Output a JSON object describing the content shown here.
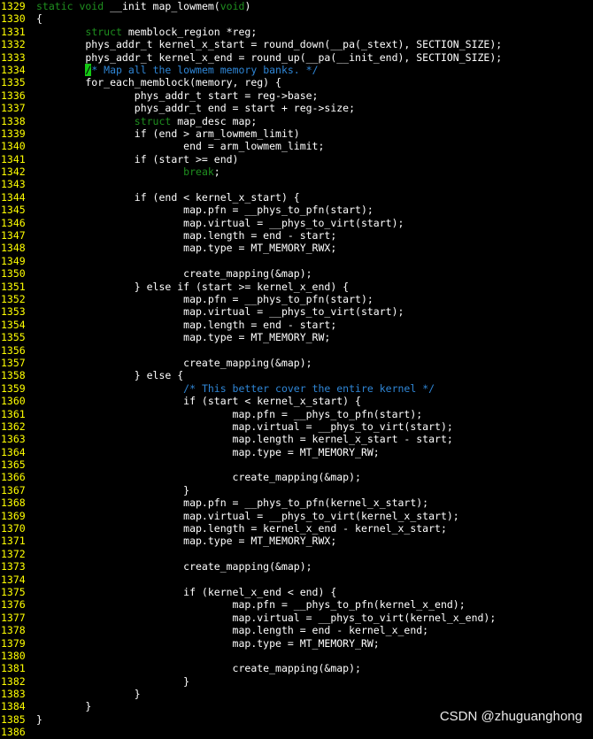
{
  "colors": {
    "background": "#000000",
    "line_number": "#ffff00",
    "text": "#ffffff",
    "keyword": "#1f8f1f",
    "comment": "#2f86d6",
    "cursor": "#14c814"
  },
  "lines": [
    {
      "n": "1329",
      "segs": [
        {
          "t": "static void",
          "c": "kw"
        },
        {
          "t": " __init map_lowmem("
        },
        {
          "t": "void",
          "c": "kw"
        },
        {
          "t": ")"
        }
      ]
    },
    {
      "n": "1330",
      "segs": [
        {
          "t": "{"
        }
      ]
    },
    {
      "n": "1331",
      "segs": [
        {
          "t": "        "
        },
        {
          "t": "struct",
          "c": "kw"
        },
        {
          "t": " memblock_region *reg;"
        }
      ]
    },
    {
      "n": "1332",
      "segs": [
        {
          "t": "        phys_addr_t kernel_x_start = round_down(__pa(_stext), SECTION_SIZE);"
        }
      ]
    },
    {
      "n": "1333",
      "segs": [
        {
          "t": "        phys_addr_t kernel_x_end = round_up(__pa(__init_end), SECTION_SIZE);"
        }
      ]
    },
    {
      "n": "1334",
      "segs": [
        {
          "t": "        "
        },
        {
          "t": "/",
          "c": "cursor"
        },
        {
          "t": "* Map all the lowmem memory banks. */",
          "c": "cm"
        }
      ]
    },
    {
      "n": "1335",
      "segs": [
        {
          "t": "        for_each_memblock(memory, reg) {"
        }
      ]
    },
    {
      "n": "1336",
      "segs": [
        {
          "t": "                phys_addr_t start = reg->base;"
        }
      ]
    },
    {
      "n": "1337",
      "segs": [
        {
          "t": "                phys_addr_t end = start + reg->size;"
        }
      ]
    },
    {
      "n": "1338",
      "segs": [
        {
          "t": "                "
        },
        {
          "t": "struct",
          "c": "kw"
        },
        {
          "t": " map_desc map;"
        }
      ]
    },
    {
      "n": "1339",
      "segs": [
        {
          "t": "                if (end > arm_lowmem_limit)"
        }
      ]
    },
    {
      "n": "1340",
      "segs": [
        {
          "t": "                        end = arm_lowmem_limit;"
        }
      ]
    },
    {
      "n": "1341",
      "segs": [
        {
          "t": "                if (start >= end)"
        }
      ]
    },
    {
      "n": "1342",
      "segs": [
        {
          "t": "                        "
        },
        {
          "t": "break",
          "c": "kw"
        },
        {
          "t": ";"
        }
      ]
    },
    {
      "n": "1343",
      "segs": [
        {
          "t": ""
        }
      ]
    },
    {
      "n": "1344",
      "segs": [
        {
          "t": "                if (end < kernel_x_start) {"
        }
      ]
    },
    {
      "n": "1345",
      "segs": [
        {
          "t": "                        map.pfn = __phys_to_pfn(start);"
        }
      ]
    },
    {
      "n": "1346",
      "segs": [
        {
          "t": "                        map.virtual = __phys_to_virt(start);"
        }
      ]
    },
    {
      "n": "1347",
      "segs": [
        {
          "t": "                        map.length = end - start;"
        }
      ]
    },
    {
      "n": "1348",
      "segs": [
        {
          "t": "                        map.type = MT_MEMORY_RWX;"
        }
      ]
    },
    {
      "n": "1349",
      "segs": [
        {
          "t": ""
        }
      ]
    },
    {
      "n": "1350",
      "segs": [
        {
          "t": "                        create_mapping(&map);"
        }
      ]
    },
    {
      "n": "1351",
      "segs": [
        {
          "t": "                } else if (start >= kernel_x_end) {"
        }
      ]
    },
    {
      "n": "1352",
      "segs": [
        {
          "t": "                        map.pfn = __phys_to_pfn(start);"
        }
      ]
    },
    {
      "n": "1353",
      "segs": [
        {
          "t": "                        map.virtual = __phys_to_virt(start);"
        }
      ]
    },
    {
      "n": "1354",
      "segs": [
        {
          "t": "                        map.length = end - start;"
        }
      ]
    },
    {
      "n": "1355",
      "segs": [
        {
          "t": "                        map.type = MT_MEMORY_RW;"
        }
      ]
    },
    {
      "n": "1356",
      "segs": [
        {
          "t": ""
        }
      ]
    },
    {
      "n": "1357",
      "segs": [
        {
          "t": "                        create_mapping(&map);"
        }
      ]
    },
    {
      "n": "1358",
      "segs": [
        {
          "t": "                } else {"
        }
      ]
    },
    {
      "n": "1359",
      "segs": [
        {
          "t": "                        "
        },
        {
          "t": "/* This better cover the entire kernel */",
          "c": "cm"
        }
      ]
    },
    {
      "n": "1360",
      "segs": [
        {
          "t": "                        if (start < kernel_x_start) {"
        }
      ]
    },
    {
      "n": "1361",
      "segs": [
        {
          "t": "                                map.pfn = __phys_to_pfn(start);"
        }
      ]
    },
    {
      "n": "1362",
      "segs": [
        {
          "t": "                                map.virtual = __phys_to_virt(start);"
        }
      ]
    },
    {
      "n": "1363",
      "segs": [
        {
          "t": "                                map.length = kernel_x_start - start;"
        }
      ]
    },
    {
      "n": "1364",
      "segs": [
        {
          "t": "                                map.type = MT_MEMORY_RW;"
        }
      ]
    },
    {
      "n": "1365",
      "segs": [
        {
          "t": ""
        }
      ]
    },
    {
      "n": "1366",
      "segs": [
        {
          "t": "                                create_mapping(&map);"
        }
      ]
    },
    {
      "n": "1367",
      "segs": [
        {
          "t": "                        }"
        }
      ]
    },
    {
      "n": "1368",
      "segs": [
        {
          "t": "                        map.pfn = __phys_to_pfn(kernel_x_start);"
        }
      ]
    },
    {
      "n": "1369",
      "segs": [
        {
          "t": "                        map.virtual = __phys_to_virt(kernel_x_start);"
        }
      ]
    },
    {
      "n": "1370",
      "segs": [
        {
          "t": "                        map.length = kernel_x_end - kernel_x_start;"
        }
      ]
    },
    {
      "n": "1371",
      "segs": [
        {
          "t": "                        map.type = MT_MEMORY_RWX;"
        }
      ]
    },
    {
      "n": "1372",
      "segs": [
        {
          "t": ""
        }
      ]
    },
    {
      "n": "1373",
      "segs": [
        {
          "t": "                        create_mapping(&map);"
        }
      ]
    },
    {
      "n": "1374",
      "segs": [
        {
          "t": ""
        }
      ]
    },
    {
      "n": "1375",
      "segs": [
        {
          "t": "                        if (kernel_x_end < end) {"
        }
      ]
    },
    {
      "n": "1376",
      "segs": [
        {
          "t": "                                map.pfn = __phys_to_pfn(kernel_x_end);"
        }
      ]
    },
    {
      "n": "1377",
      "segs": [
        {
          "t": "                                map.virtual = __phys_to_virt(kernel_x_end);"
        }
      ]
    },
    {
      "n": "1378",
      "segs": [
        {
          "t": "                                map.length = end - kernel_x_end;"
        }
      ]
    },
    {
      "n": "1379",
      "segs": [
        {
          "t": "                                map.type = MT_MEMORY_RW;"
        }
      ]
    },
    {
      "n": "1380",
      "segs": [
        {
          "t": ""
        }
      ]
    },
    {
      "n": "1381",
      "segs": [
        {
          "t": "                                create_mapping(&map);"
        }
      ]
    },
    {
      "n": "1382",
      "segs": [
        {
          "t": "                        }"
        }
      ]
    },
    {
      "n": "1383",
      "segs": [
        {
          "t": "                }"
        }
      ]
    },
    {
      "n": "1384",
      "segs": [
        {
          "t": "        }"
        }
      ]
    },
    {
      "n": "1385",
      "segs": [
        {
          "t": "}"
        }
      ]
    },
    {
      "n": "1386",
      "segs": [
        {
          "t": ""
        }
      ]
    }
  ],
  "watermark": "CSDN @zhuguanghong"
}
